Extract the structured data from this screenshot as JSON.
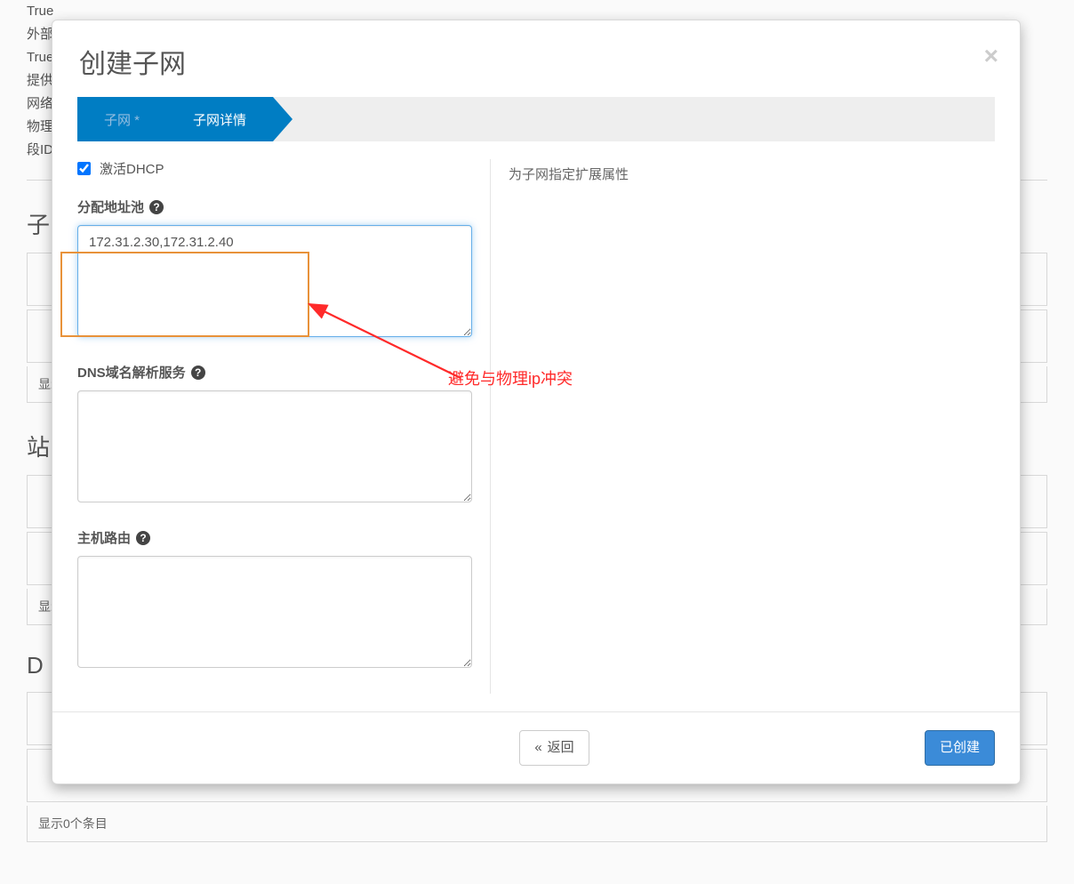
{
  "background": {
    "lines": [
      "True",
      "外部",
      "True",
      "提供",
      "网络",
      "物理",
      "段ID"
    ],
    "footerItems": "显示0个条目",
    "heading1": "子",
    "heading2": "站",
    "heading3": "D"
  },
  "modal": {
    "title": "创建子网",
    "closeIcon": "×",
    "wizard": {
      "step1": "子网 *",
      "step2": "子网详情"
    },
    "form": {
      "dhcpLabel": "激活DHCP",
      "dhcpChecked": true,
      "poolLabel": "分配地址池",
      "poolValue": "172.31.2.30,172.31.2.40",
      "dnsLabel": "DNS域名解析服务",
      "dnsValue": "",
      "routesLabel": "主机路由",
      "routesValue": "",
      "helpIcon": "?"
    },
    "rightHelp": "为子网指定扩展属性",
    "footer": {
      "backLabel": "返回",
      "backIcon": "«",
      "submitLabel": "已创建"
    }
  },
  "annotation": {
    "text": "避免与物理ip冲突"
  }
}
